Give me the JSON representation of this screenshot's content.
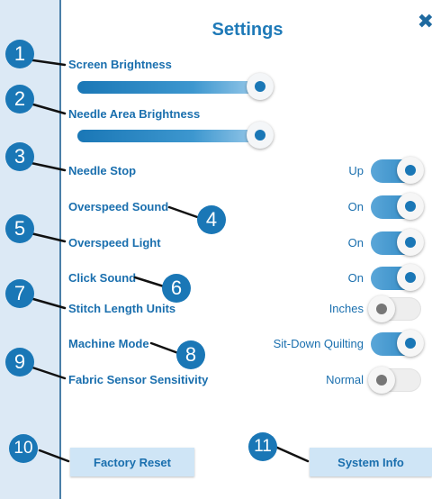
{
  "header": {
    "title": "Settings",
    "close_glyph": "✖"
  },
  "settings": {
    "screen_brightness": {
      "label": "Screen Brightness",
      "level_percent": 95
    },
    "needle_area_brightness": {
      "label": "Needle Area Brightness",
      "level_percent": 95
    },
    "needle_stop": {
      "label": "Needle Stop",
      "value": "Up",
      "on": true
    },
    "overspeed_sound": {
      "label": "Overspeed Sound",
      "value": "On",
      "on": true
    },
    "overspeed_light": {
      "label": "Overspeed Light",
      "value": "On",
      "on": true
    },
    "click_sound": {
      "label": "Click Sound",
      "value": "On",
      "on": true
    },
    "stitch_length_units": {
      "label": "Stitch Length Units",
      "value": "Inches",
      "on": false
    },
    "machine_mode": {
      "label": "Machine Mode",
      "value": "Sit-Down Quilting",
      "on": true
    },
    "fabric_sensor_sensitivity": {
      "label": "Fabric Sensor Sensitivity",
      "value": "Normal",
      "on": false
    }
  },
  "buttons": {
    "factory_reset": "Factory Reset",
    "system_info": "System Info"
  },
  "callouts": [
    "1",
    "2",
    "3",
    "4",
    "5",
    "6",
    "7",
    "8",
    "9",
    "10",
    "11"
  ],
  "colors": {
    "accent": "#1a77b6",
    "panel_bg": "#ffffff",
    "page_bg": "#dce9f5",
    "button_bg": "#cfe5f6"
  }
}
